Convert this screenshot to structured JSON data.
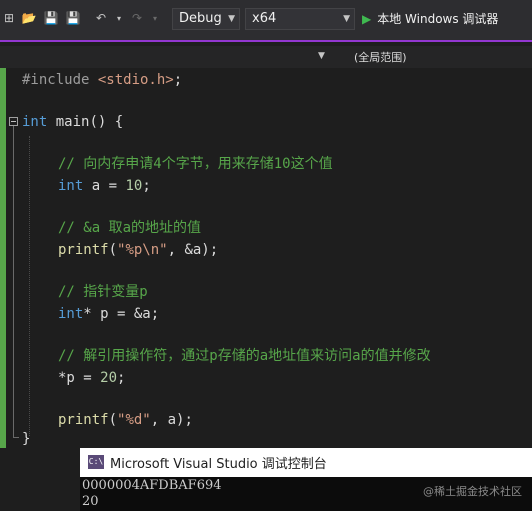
{
  "toolbar": {
    "config": "Debug",
    "platform": "x64",
    "run_label": "本地 Windows 调试器"
  },
  "navbar": {
    "scope": "(全局范围)"
  },
  "code": {
    "line1": {
      "pp": "#include ",
      "str": "<stdio.h>",
      "txt": ";"
    },
    "line2": {
      "kw": "int",
      "fn": " main",
      "txt": "() {"
    },
    "c1": "// 向内存申请4个字节，用来存储10这个值",
    "s1": {
      "kw": "int",
      "txt": " a = ",
      "num": "10",
      "end": ";"
    },
    "c2": "// &a 取a的地址的值",
    "s2": {
      "fn": "printf",
      "txt1": "(",
      "str": "\"%p\\n\"",
      "txt2": ", &a);"
    },
    "c3": "// 指针变量p",
    "s3": {
      "kw": "int",
      "txt": "* p = &a;"
    },
    "c4": "// 解引用操作符，通过p存储的a地址值来访问a的值并修改",
    "s4": {
      "txt": "*p = ",
      "num": "20",
      "end": ";"
    },
    "s5": {
      "fn": "printf",
      "txt1": "(",
      "str": "\"%d\"",
      "txt2": ", a);"
    },
    "close": "}"
  },
  "console": {
    "icon_text": "C:\\",
    "title": "Microsoft Visual Studio 调试控制台",
    "output": [
      "0000004AFDBAF694",
      "20"
    ],
    "watermark": "@稀土掘金技术社区"
  },
  "colors": {
    "accent_purple": "#a83cf0",
    "comment": "#57a64a",
    "keyword": "#569cd6",
    "string": "#d69d85",
    "number": "#b5cea8"
  }
}
